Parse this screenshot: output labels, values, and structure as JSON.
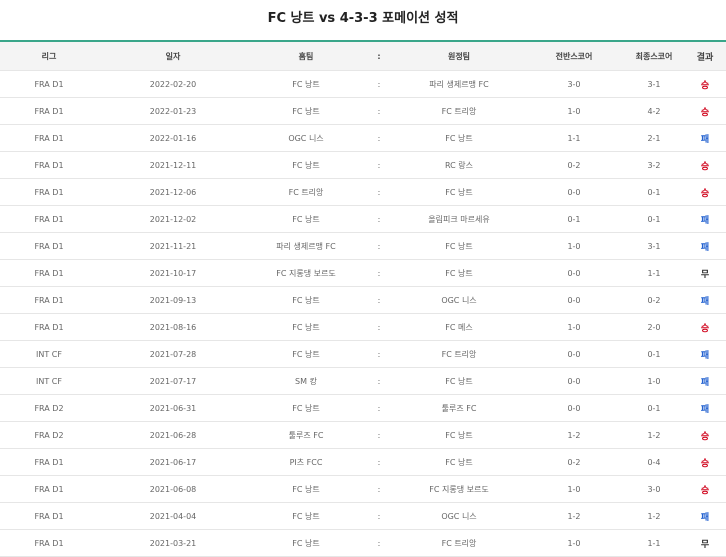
{
  "title": "FC 낭트 vs 4-3-3 포메이션 성적",
  "colors": {
    "accent": "#3aa68a",
    "win": "#d0021b",
    "loss": "#1e5ecf",
    "draw": "#333333"
  },
  "headers": {
    "league": "리그",
    "date": "일자",
    "home": "홈팀",
    "sep": ":",
    "away": "원정팀",
    "half": "전반스코어",
    "full": "최종스코어",
    "result": "결과"
  },
  "rows": [
    {
      "league": "FRA D1",
      "date": "2022-02-20",
      "home": "FC 낭트",
      "away": "파리 생제르맹 FC",
      "half": "3-0",
      "full": "3-1",
      "result": "승"
    },
    {
      "league": "FRA D1",
      "date": "2022-01-23",
      "home": "FC 낭트",
      "away": "FC 트리앙",
      "half": "1-0",
      "full": "4-2",
      "result": "승"
    },
    {
      "league": "FRA D1",
      "date": "2022-01-16",
      "home": "OGC 니스",
      "away": "FC 낭트",
      "half": "1-1",
      "full": "2-1",
      "result": "패"
    },
    {
      "league": "FRA D1",
      "date": "2021-12-11",
      "home": "FC 낭트",
      "away": "RC 랑스",
      "half": "0-2",
      "full": "3-2",
      "result": "승"
    },
    {
      "league": "FRA D1",
      "date": "2021-12-06",
      "home": "FC 트리앙",
      "away": "FC 낭트",
      "half": "0-0",
      "full": "0-1",
      "result": "승"
    },
    {
      "league": "FRA D1",
      "date": "2021-12-02",
      "home": "FC 낭트",
      "away": "올림피크 마르세유",
      "half": "0-1",
      "full": "0-1",
      "result": "패"
    },
    {
      "league": "FRA D1",
      "date": "2021-11-21",
      "home": "파리 생제르맹 FC",
      "away": "FC 낭트",
      "half": "1-0",
      "full": "3-1",
      "result": "패"
    },
    {
      "league": "FRA D1",
      "date": "2021-10-17",
      "home": "FC 지롱댕 보르도",
      "away": "FC 낭트",
      "half": "0-0",
      "full": "1-1",
      "result": "무"
    },
    {
      "league": "FRA D1",
      "date": "2021-09-13",
      "home": "FC 낭트",
      "away": "OGC 니스",
      "half": "0-0",
      "full": "0-2",
      "result": "패"
    },
    {
      "league": "FRA D1",
      "date": "2021-08-16",
      "home": "FC 낭트",
      "away": "FC 메스",
      "half": "1-0",
      "full": "2-0",
      "result": "승"
    },
    {
      "league": "INT CF",
      "date": "2021-07-28",
      "home": "FC 낭트",
      "away": "FC 트리앙",
      "half": "0-0",
      "full": "0-1",
      "result": "패"
    },
    {
      "league": "INT CF",
      "date": "2021-07-17",
      "home": "SM 캉",
      "away": "FC 낭트",
      "half": "0-0",
      "full": "1-0",
      "result": "패"
    },
    {
      "league": "FRA D2",
      "date": "2021-06-31",
      "home": "FC 낭트",
      "away": "툴루즈 FC",
      "half": "0-0",
      "full": "0-1",
      "result": "패"
    },
    {
      "league": "FRA D2",
      "date": "2021-06-28",
      "home": "툴루즈 FC",
      "away": "FC 낭트",
      "half": "1-2",
      "full": "1-2",
      "result": "승"
    },
    {
      "league": "FRA D1",
      "date": "2021-06-17",
      "home": "PI츠 FCC",
      "away": "FC 낭트",
      "half": "0-2",
      "full": "0-4",
      "result": "승"
    },
    {
      "league": "FRA D1",
      "date": "2021-06-08",
      "home": "FC 낭트",
      "away": "FC 지롱댕 보르도",
      "half": "1-0",
      "full": "3-0",
      "result": "승"
    },
    {
      "league": "FRA D1",
      "date": "2021-04-04",
      "home": "FC 낭트",
      "away": "OGC 니스",
      "half": "1-2",
      "full": "1-2",
      "result": "패"
    },
    {
      "league": "FRA D1",
      "date": "2021-03-21",
      "home": "FC 낭트",
      "away": "FC 트리앙",
      "half": "1-0",
      "full": "1-1",
      "result": "무"
    }
  ]
}
